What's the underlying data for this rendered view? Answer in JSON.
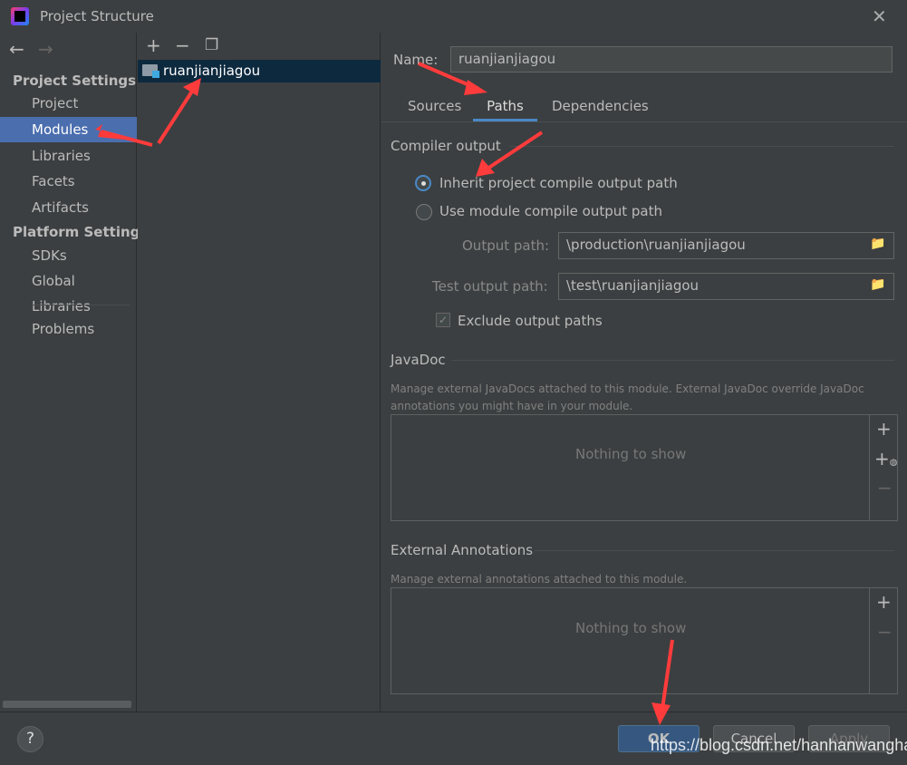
{
  "window": {
    "title": "Project Structure",
    "close_icon": "close-icon"
  },
  "sidebar": {
    "sections": [
      {
        "label": "Project Settings",
        "items": [
          "Project",
          "Modules",
          "Libraries",
          "Facets",
          "Artifacts"
        ]
      },
      {
        "label": "Platform Settings",
        "items": [
          "SDKs",
          "Global Libraries"
        ]
      }
    ],
    "problems": "Problems",
    "selected": "Modules"
  },
  "modules": {
    "items": [
      "ruanjianjiagou"
    ]
  },
  "details": {
    "name_label": "Name:",
    "name_value": "ruanjianjiagou",
    "tabs": [
      "Sources",
      "Paths",
      "Dependencies"
    ],
    "active_tab": "Paths",
    "compiler_output": {
      "title": "Compiler output",
      "inherit": "Inherit project compile output path",
      "use_module": "Use module compile output path",
      "selected": "inherit",
      "output_label": "Output path:",
      "output_value": "\\production\\ruanjianjiagou",
      "test_label": "Test output path:",
      "test_value": "\\test\\ruanjianjiagou",
      "exclude": "Exclude output paths",
      "exclude_checked": true
    },
    "javadoc": {
      "title": "JavaDoc",
      "desc1": "Manage external JavaDocs attached to this module. External JavaDoc override JavaDoc",
      "desc2": "annotations you might have in your module.",
      "empty": "Nothing to show"
    },
    "annotations": {
      "title": "External Annotations",
      "desc": "Manage external annotations attached to this module.",
      "empty": "Nothing to show"
    }
  },
  "footer": {
    "help": "?",
    "ok": "OK",
    "cancel": "Cancel",
    "apply": "Apply"
  },
  "watermark": "https://blog.csdn.net/hanhanwanghaha",
  "colors": {
    "selection": "#4b6eaf",
    "accent": "#4a88c7",
    "annotation_arrow": "#ff3b3b"
  }
}
